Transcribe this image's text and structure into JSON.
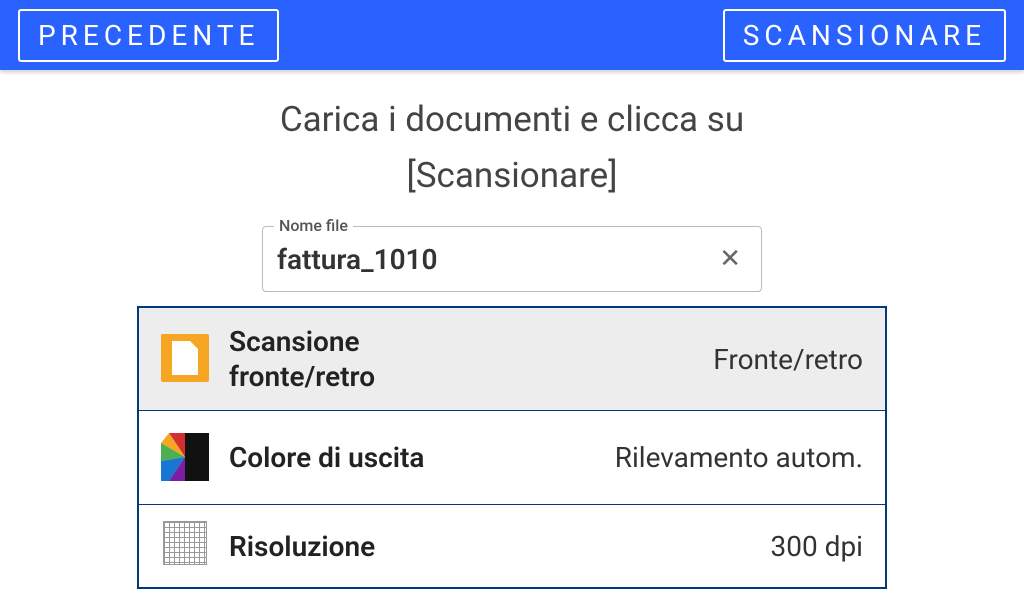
{
  "header": {
    "back_label": "PRECEDENTE",
    "scan_label": "SCANSIONARE"
  },
  "title_line1": "Carica i documenti e clicca su",
  "title_line2": "[Scansionare]",
  "filename": {
    "label": "Nome file",
    "value": "fattura_1010"
  },
  "settings": {
    "duplex": {
      "label": "Scansione fronte/retro",
      "value": "Fronte/retro"
    },
    "color": {
      "label": "Colore di uscita",
      "value": "Rilevamento autom."
    },
    "resolution": {
      "label": "Risoluzione",
      "value": "300 dpi"
    }
  }
}
